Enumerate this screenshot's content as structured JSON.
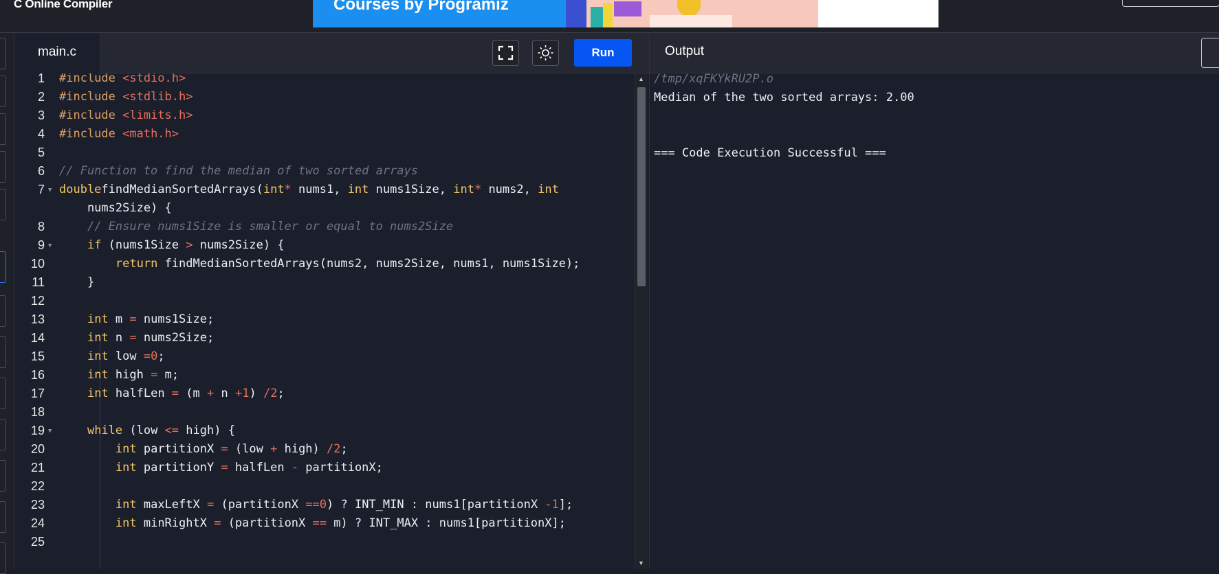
{
  "app": {
    "title": "C Online Compiler"
  },
  "banner": {
    "text": "Courses by Programiz"
  },
  "editor": {
    "tab_label": "main.c",
    "run_label": "Run",
    "lines": [
      {
        "n": "1",
        "fold": false,
        "tokens": [
          [
            "pp",
            "#include "
          ],
          [
            "str",
            "<stdio.h>"
          ]
        ]
      },
      {
        "n": "2",
        "fold": false,
        "tokens": [
          [
            "pp",
            "#include "
          ],
          [
            "str",
            "<stdlib.h>"
          ]
        ]
      },
      {
        "n": "3",
        "fold": false,
        "tokens": [
          [
            "pp",
            "#include "
          ],
          [
            "str",
            "<limits.h>"
          ]
        ]
      },
      {
        "n": "4",
        "fold": false,
        "tokens": [
          [
            "pp",
            "#include "
          ],
          [
            "str",
            "<math.h>"
          ]
        ]
      },
      {
        "n": "5",
        "fold": false,
        "tokens": []
      },
      {
        "n": "6",
        "fold": false,
        "tokens": [
          [
            "cm",
            "// Function to find the median of two sorted arrays"
          ]
        ]
      },
      {
        "n": "7",
        "fold": true,
        "tokens": [
          [
            "kw",
            "double"
          ],
          [
            "",
            "findMedianSortedArrays("
          ],
          [
            "kw",
            "int"
          ],
          [
            "op",
            "*"
          ],
          [
            "",
            " nums1, "
          ],
          [
            "kw",
            "int"
          ],
          [
            "",
            " nums1Size, "
          ],
          [
            "kw",
            "int"
          ],
          [
            "op",
            "*"
          ],
          [
            "",
            " nums2, "
          ],
          [
            "kw",
            "int"
          ]
        ]
      },
      {
        "n": "",
        "fold": false,
        "tokens": [
          [
            "",
            "    nums2Size) {"
          ]
        ]
      },
      {
        "n": "8",
        "fold": false,
        "tokens": [
          [
            "",
            "    "
          ],
          [
            "cm",
            "// Ensure nums1Size is smaller or equal to nums2Size"
          ]
        ]
      },
      {
        "n": "9",
        "fold": true,
        "tokens": [
          [
            "",
            "    "
          ],
          [
            "kw",
            "if"
          ],
          [
            "",
            " (nums1Size "
          ],
          [
            "op",
            ">"
          ],
          [
            "",
            " nums2Size) {"
          ]
        ]
      },
      {
        "n": "10",
        "fold": false,
        "tokens": [
          [
            "",
            "        "
          ],
          [
            "kw",
            "return"
          ],
          [
            "",
            " findMedianSortedArrays(nums2, nums2Size, nums1, nums1Size);"
          ]
        ]
      },
      {
        "n": "11",
        "fold": false,
        "tokens": [
          [
            "",
            "    }"
          ]
        ]
      },
      {
        "n": "12",
        "fold": false,
        "tokens": []
      },
      {
        "n": "13",
        "fold": false,
        "tokens": [
          [
            "",
            "    "
          ],
          [
            "kw",
            "int"
          ],
          [
            "",
            " m "
          ],
          [
            "op",
            "="
          ],
          [
            "",
            " nums1Size;"
          ]
        ]
      },
      {
        "n": "14",
        "fold": false,
        "tokens": [
          [
            "",
            "    "
          ],
          [
            "kw",
            "int"
          ],
          [
            "",
            " n "
          ],
          [
            "op",
            "="
          ],
          [
            "",
            " nums2Size;"
          ]
        ]
      },
      {
        "n": "15",
        "fold": false,
        "tokens": [
          [
            "",
            "    "
          ],
          [
            "kw",
            "int"
          ],
          [
            "",
            " low "
          ],
          [
            "op",
            "="
          ],
          [
            " ",
            ""
          ],
          [
            "num",
            "0"
          ],
          [
            "",
            ";"
          ]
        ]
      },
      {
        "n": "16",
        "fold": false,
        "tokens": [
          [
            "",
            "    "
          ],
          [
            "kw",
            "int"
          ],
          [
            "",
            " high "
          ],
          [
            "op",
            "="
          ],
          [
            "",
            " m;"
          ]
        ]
      },
      {
        "n": "17",
        "fold": false,
        "tokens": [
          [
            "",
            "    "
          ],
          [
            "kw",
            "int"
          ],
          [
            "",
            " halfLen "
          ],
          [
            "op",
            "="
          ],
          [
            "",
            " (m "
          ],
          [
            "op",
            "+"
          ],
          [
            "",
            " n "
          ],
          [
            "op",
            "+"
          ],
          [
            " ",
            ""
          ],
          [
            "num",
            "1"
          ],
          [
            "",
            ") "
          ],
          [
            "op",
            "/"
          ],
          [
            " ",
            ""
          ],
          [
            "num",
            "2"
          ],
          [
            "",
            ";"
          ]
        ]
      },
      {
        "n": "18",
        "fold": false,
        "tokens": []
      },
      {
        "n": "19",
        "fold": true,
        "tokens": [
          [
            "",
            "    "
          ],
          [
            "kw",
            "while"
          ],
          [
            "",
            " (low "
          ],
          [
            "op",
            "<="
          ],
          [
            "",
            " high) {"
          ]
        ]
      },
      {
        "n": "20",
        "fold": false,
        "tokens": [
          [
            "",
            "        "
          ],
          [
            "kw",
            "int"
          ],
          [
            "",
            " partitionX "
          ],
          [
            "op",
            "="
          ],
          [
            "",
            " (low "
          ],
          [
            "op",
            "+"
          ],
          [
            "",
            " high) "
          ],
          [
            "op",
            "/"
          ],
          [
            " ",
            ""
          ],
          [
            "num",
            "2"
          ],
          [
            "",
            ";"
          ]
        ]
      },
      {
        "n": "21",
        "fold": false,
        "tokens": [
          [
            "",
            "        "
          ],
          [
            "kw",
            "int"
          ],
          [
            "",
            " partitionY "
          ],
          [
            "op",
            "="
          ],
          [
            "",
            " halfLen "
          ],
          [
            "op",
            "-"
          ],
          [
            "",
            " partitionX;"
          ]
        ]
      },
      {
        "n": "22",
        "fold": false,
        "tokens": []
      },
      {
        "n": "23",
        "fold": false,
        "tokens": [
          [
            "",
            "        "
          ],
          [
            "kw",
            "int"
          ],
          [
            "",
            " maxLeftX "
          ],
          [
            "op",
            "="
          ],
          [
            "",
            " (partitionX "
          ],
          [
            "op",
            "=="
          ],
          [
            " ",
            ""
          ],
          [
            "num",
            "0"
          ],
          [
            "",
            ") ? INT_MIN : nums1[partitionX "
          ],
          [
            "op",
            "-"
          ],
          [
            " ",
            ""
          ],
          [
            "num",
            "1"
          ],
          [
            "",
            "];"
          ]
        ]
      },
      {
        "n": "24",
        "fold": false,
        "tokens": [
          [
            "",
            "        "
          ],
          [
            "kw",
            "int"
          ],
          [
            "",
            " minRightX "
          ],
          [
            "op",
            "="
          ],
          [
            "",
            " (partitionX "
          ],
          [
            "op",
            "=="
          ],
          [
            "",
            " m) ? INT_MAX : nums1[partitionX];"
          ]
        ]
      },
      {
        "n": "25",
        "fold": false,
        "tokens": []
      }
    ]
  },
  "output": {
    "title": "Output",
    "path": "/tmp/xqFKYkRU2P.o",
    "result": "Median of the two sorted arrays: 2.00",
    "status": "=== Code Execution Successful ==="
  }
}
